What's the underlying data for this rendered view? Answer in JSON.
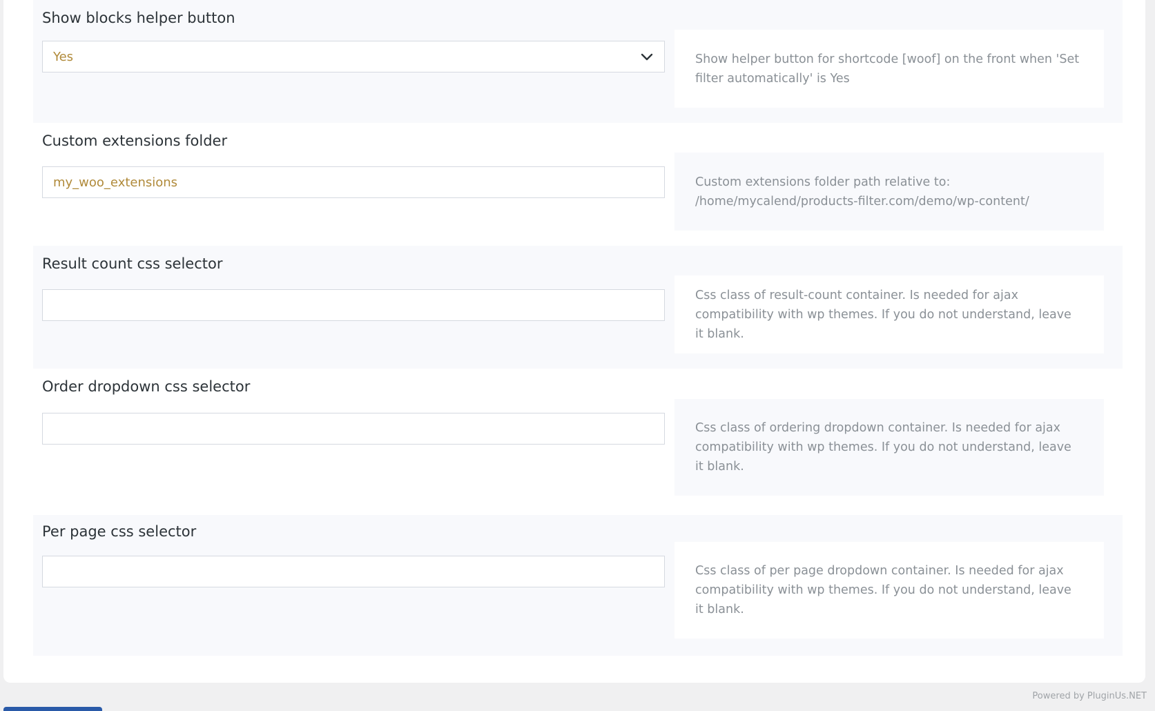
{
  "settings": [
    {
      "label": "Show blocks helper button",
      "value": "Yes",
      "description": "Show helper button for shortcode [woof] on the front when 'Set filter automatically' is Yes"
    },
    {
      "label": "Custom extensions folder",
      "value": "my_woo_extensions",
      "description": "Custom extensions folder path relative to: /home/mycalend/products-filter.com/demo/wp-content/"
    },
    {
      "label": "Result count css selector",
      "value": "",
      "description": "Css class of result-count container. Is needed for ajax compatibility with wp themes. If you do not understand, leave it blank."
    },
    {
      "label": "Order dropdown css selector",
      "value": "",
      "description": "Css class of ordering dropdown container. Is needed for ajax compatibility with wp themes. If you do not understand, leave it blank."
    },
    {
      "label": "Per page css selector",
      "value": "",
      "description": "Css class of per page dropdown container. Is needed for ajax compatibility with wp themes. If you do not understand, leave it blank."
    }
  ],
  "footer": {
    "powered_by": "Powered by PluginUs.NET"
  },
  "colors": {
    "value_text": "#b08a3a",
    "label_text": "#2c3338",
    "description_text": "#8a9096",
    "row_shade": "#f8f9fc",
    "accent": "#2a5aa8"
  },
  "icons": {
    "select_indicator": "chevron-down-icon"
  }
}
